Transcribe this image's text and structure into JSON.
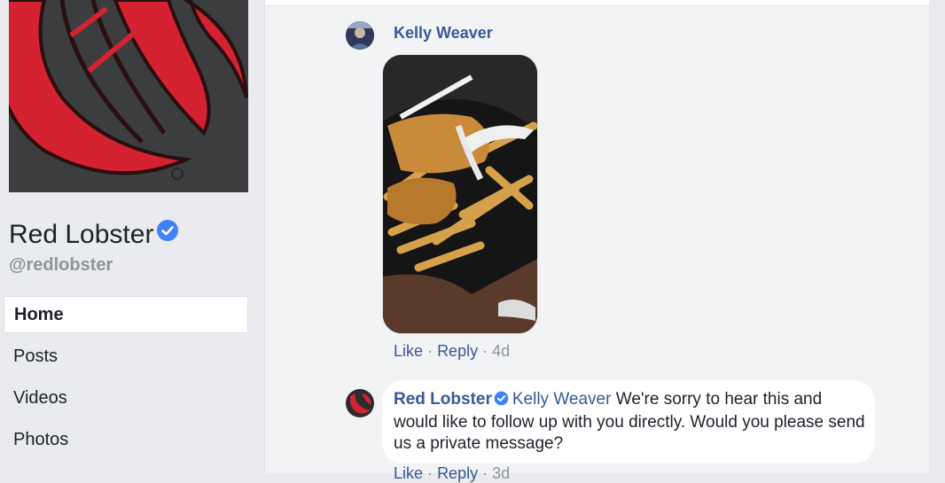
{
  "page": {
    "name": "Red Lobster",
    "handle": "@redlobster"
  },
  "nav": {
    "items": [
      {
        "label": "Home",
        "active": true
      },
      {
        "label": "Posts"
      },
      {
        "label": "Videos"
      },
      {
        "label": "Photos"
      }
    ]
  },
  "comments": [
    {
      "author": "Kelly Weaver",
      "actions": {
        "like": "Like",
        "reply": "Reply",
        "time": "4d"
      }
    },
    {
      "author": "Red Lobster",
      "mention": "Kelly Weaver",
      "text": "We're sorry to hear this and would like to follow up with you directly. Would you please send us a private message?",
      "actions": {
        "like": "Like",
        "reply": "Reply",
        "time": "3d"
      }
    }
  ],
  "colors": {
    "link": "#385898",
    "verified": "#4080ff",
    "brand_red": "#d2232f",
    "background": "#e9ebee"
  },
  "icons": {
    "verified": "verified-badge-icon"
  }
}
